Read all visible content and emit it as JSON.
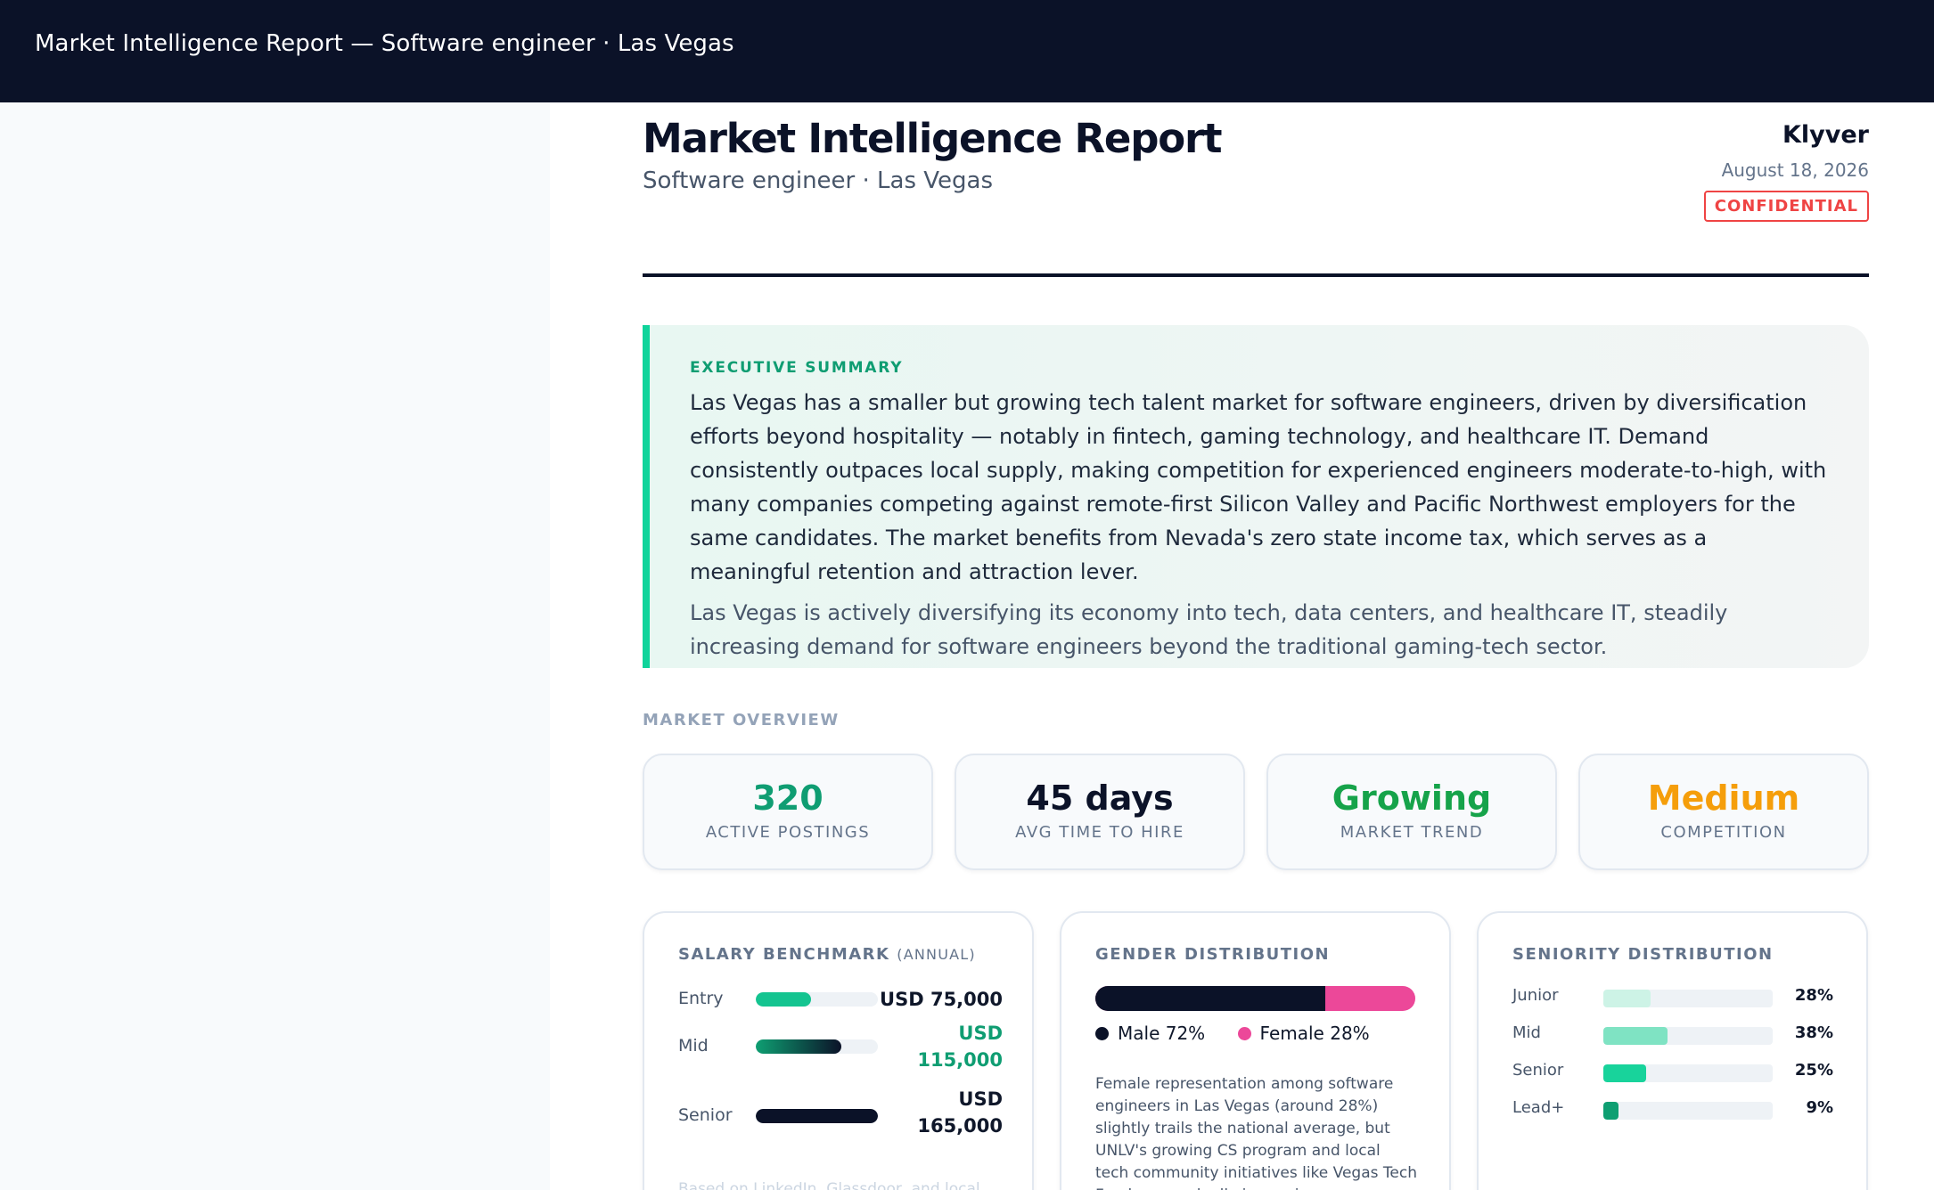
{
  "topbar": {
    "title": "Market Intelligence Report — Software engineer · Las Vegas"
  },
  "report": {
    "title": "Market Intelligence Report",
    "subtitle": "Software engineer · Las Vegas",
    "brand": "Klyver",
    "date": "August 18, 2026",
    "badge": "CONFIDENTIAL"
  },
  "summary": {
    "label": "EXECUTIVE SUMMARY",
    "body": "Las Vegas has a smaller but growing tech talent market for software engineers, driven by diversification efforts beyond hospitality — notably in fintech, gaming technology, and healthcare IT. Demand consistently outpaces local supply, making competition for experienced engineers moderate-to-high, with many companies competing against remote-first Silicon Valley and Pacific Northwest employers for the same candidates. The market benefits from Nevada's zero state income tax, which serves as a meaningful retention and attraction lever.",
    "note": "Las Vegas is actively diversifying its economy into tech, data centers, and healthcare IT, steadily increasing demand for software engineers beyond the traditional gaming-tech sector."
  },
  "overview": {
    "label": "MARKET OVERVIEW",
    "kpis": [
      {
        "value": "320",
        "label": "ACTIVE POSTINGS",
        "color": "#0f9d72"
      },
      {
        "value": "45 days",
        "label": "AVG TIME TO HIRE",
        "color": "#0b1228"
      },
      {
        "value": "Growing",
        "label": "MARKET TREND",
        "color": "#16a34a"
      },
      {
        "value": "Medium",
        "label": "COMPETITION",
        "color": "#f59e0b"
      }
    ]
  },
  "salary": {
    "title": "SALARY BENCHMARK",
    "title_sub": "(ANNUAL)",
    "rows": [
      {
        "level": "Entry",
        "amount": "USD 75,000",
        "fill": 0.45
      },
      {
        "level": "Mid",
        "amount": "USD 115,000",
        "fill": 0.7
      },
      {
        "level": "Senior",
        "amount": "USD 165,000",
        "fill": 1.0
      }
    ],
    "note": "Based on LinkedIn, Glassdoor, and local"
  },
  "gender": {
    "title": "GENDER DISTRIBUTION",
    "male_label": "Male 72%",
    "female_label": "Female 28%",
    "male_share": 0.72,
    "female_share": 0.28,
    "note": "Female representation among software engineers in Las Vegas (around 28%) slightly trails the national average, but UNLV's growing CS program and local tech community initiatives like Vegas Tech Fund are gradually improving"
  },
  "seniority": {
    "title": "SENIORITY DISTRIBUTION",
    "rows": [
      {
        "level": "Junior",
        "pct": "28%",
        "share": 0.28,
        "color": "#cdf3e6"
      },
      {
        "level": "Mid",
        "pct": "38%",
        "share": 0.38,
        "color": "#7fe3c3"
      },
      {
        "level": "Senior",
        "pct": "25%",
        "share": 0.25,
        "color": "#18d39b"
      },
      {
        "level": "Lead+",
        "pct": "9%",
        "share": 0.09,
        "color": "#0e9f72"
      }
    ]
  },
  "colors": {
    "accent": "#10d49b",
    "navy": "#0b1228",
    "female": "#ec4899",
    "confidential": "#ef4444"
  }
}
